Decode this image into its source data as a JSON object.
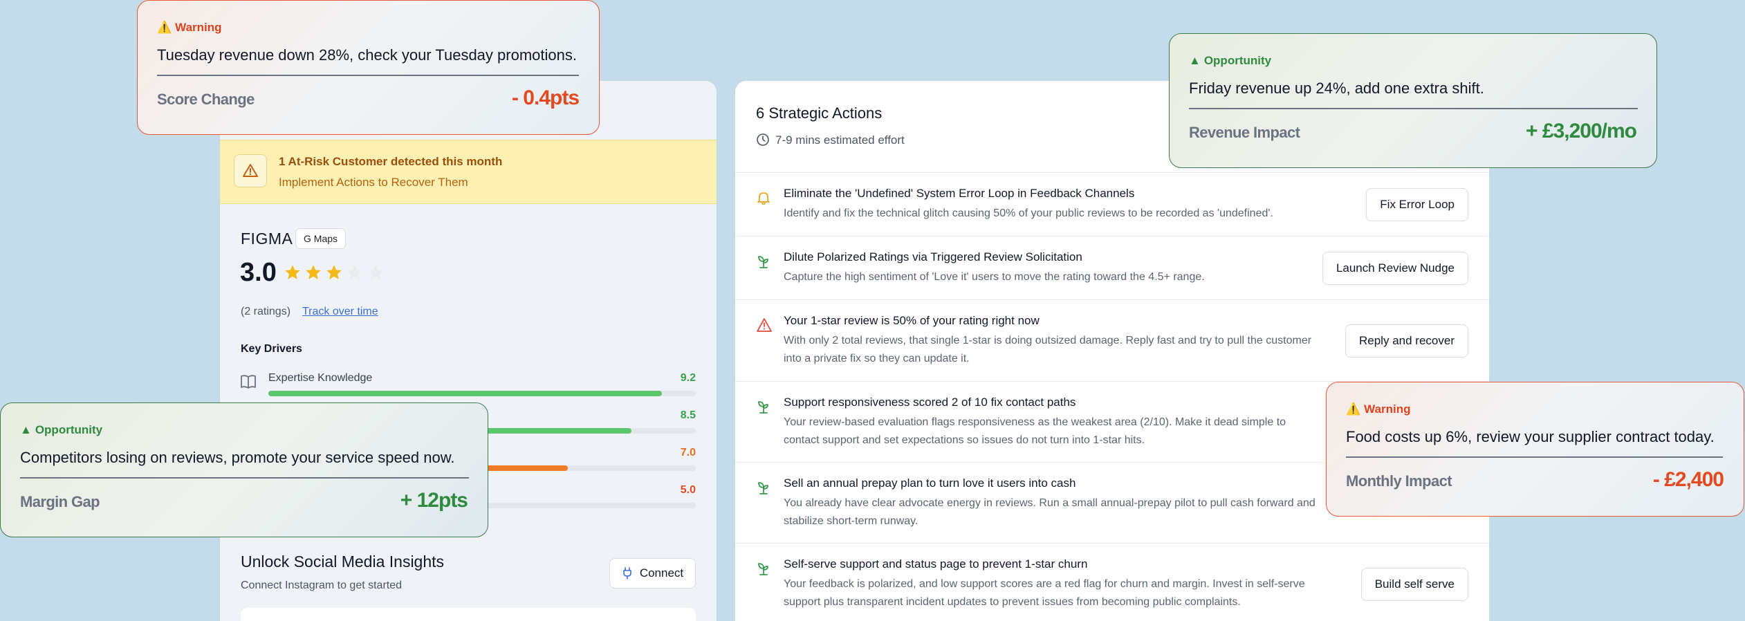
{
  "left_panel": {
    "at_risk": {
      "title": "1 At-Risk Customer detected this month",
      "subtitle": "Implement Actions to Recover Them"
    },
    "business_name": "FIGMA",
    "source_badge": "G Maps",
    "rating": "3.0",
    "rating_stars": 3,
    "rating_stars_max": 5,
    "ratings_count": "(2 ratings)",
    "track_link": "Track over time",
    "key_drivers_title": "Key Drivers",
    "drivers": [
      {
        "label": "Expertise Knowledge",
        "score": "9.2",
        "fill": 0.92,
        "color": "#5cc66e",
        "score_color": "#3aa24d"
      },
      {
        "label": "",
        "score": "8.5",
        "fill": 0.85,
        "color": "#5cc66e",
        "score_color": "#3aa24d"
      },
      {
        "label": "",
        "score": "7.0",
        "fill": 0.7,
        "color": "#f07c2a",
        "score_color": "#e86d1f"
      },
      {
        "label": "",
        "score": "5.0",
        "fill": 0.5,
        "color": "#e3e6ea",
        "score_color": "#e4491f"
      }
    ],
    "social": {
      "title": "Unlock Social Media Insights",
      "subtitle": "Connect Instagram to get started",
      "connect_label": "Connect"
    }
  },
  "right_panel": {
    "title": "6 Strategic Actions",
    "effort": "7-9 mins estimated effort",
    "actions": [
      {
        "icon": "bell-icon",
        "title": "Eliminate the 'Undefined' System Error Loop in Feedback Channels",
        "desc": "Identify and fix the technical glitch causing 50% of your public reviews to be recorded as 'undefined'.",
        "button": "Fix Error Loop"
      },
      {
        "icon": "sprout-icon",
        "title": "Dilute Polarized Ratings via Triggered Review Solicitation",
        "desc": "Capture the high sentiment of 'Love it' users to move the rating toward the 4.5+ range.",
        "button": "Launch Review Nudge"
      },
      {
        "icon": "alert-triangle-icon",
        "title": "Your 1-star review is 50% of your rating right now",
        "desc": "With only 2 total reviews, that single 1-star is doing outsized damage. Reply fast and try to pull the customer into a private fix so they can update it.",
        "button": "Reply and recover"
      },
      {
        "icon": "sprout-icon",
        "title": "Support responsiveness scored 2 of 10 fix contact paths",
        "desc": "Your review-based evaluation flags responsiveness as the weakest area (2/10). Make it dead simple to contact support and set expectations so issues do not turn into 1-star hits.",
        "button": ""
      },
      {
        "icon": "sprout-icon",
        "title": "Sell an annual prepay plan to turn love it users into cash",
        "desc": "You already have clear advocate energy in reviews. Run a small annual-prepay pilot to pull cash forward and stabilize short-term runway.",
        "button": ""
      },
      {
        "icon": "sprout-icon",
        "title": "Self-serve support and status page to prevent 1-star churn",
        "desc": "Your feedback is polarized, and low support scores are a red flag for churn and margin. Invest in self-serve support plus transparent incident updates to prevent issues from becoming public complaints.",
        "button": "Build self serve"
      }
    ]
  },
  "cards": {
    "warn1": {
      "tag": "Warning",
      "message": "Tuesday revenue down 28%, check your Tuesday promotions.",
      "metric_label": "Score Change",
      "metric_value": "- 0.4pts"
    },
    "opp1": {
      "tag": "Opportunity",
      "message": "Friday revenue up 24%, add one extra shift.",
      "metric_label": "Revenue Impact",
      "metric_value": "+ £3,200/mo"
    },
    "opp2": {
      "tag": "Opportunity",
      "message": "Competitors losing on reviews, promote your service speed now.",
      "metric_label": "Margin Gap",
      "metric_value": "+ 12pts"
    },
    "warn2": {
      "tag": "Warning",
      "message": "Food costs up 6%, review your supplier contract today.",
      "metric_label": "Monthly Impact",
      "metric_value": "- £2,400"
    }
  },
  "colors": {
    "background": "#c4dce9",
    "warning": "#e4491f",
    "opportunity": "#2e8b3e",
    "link": "#3b6fd8"
  }
}
